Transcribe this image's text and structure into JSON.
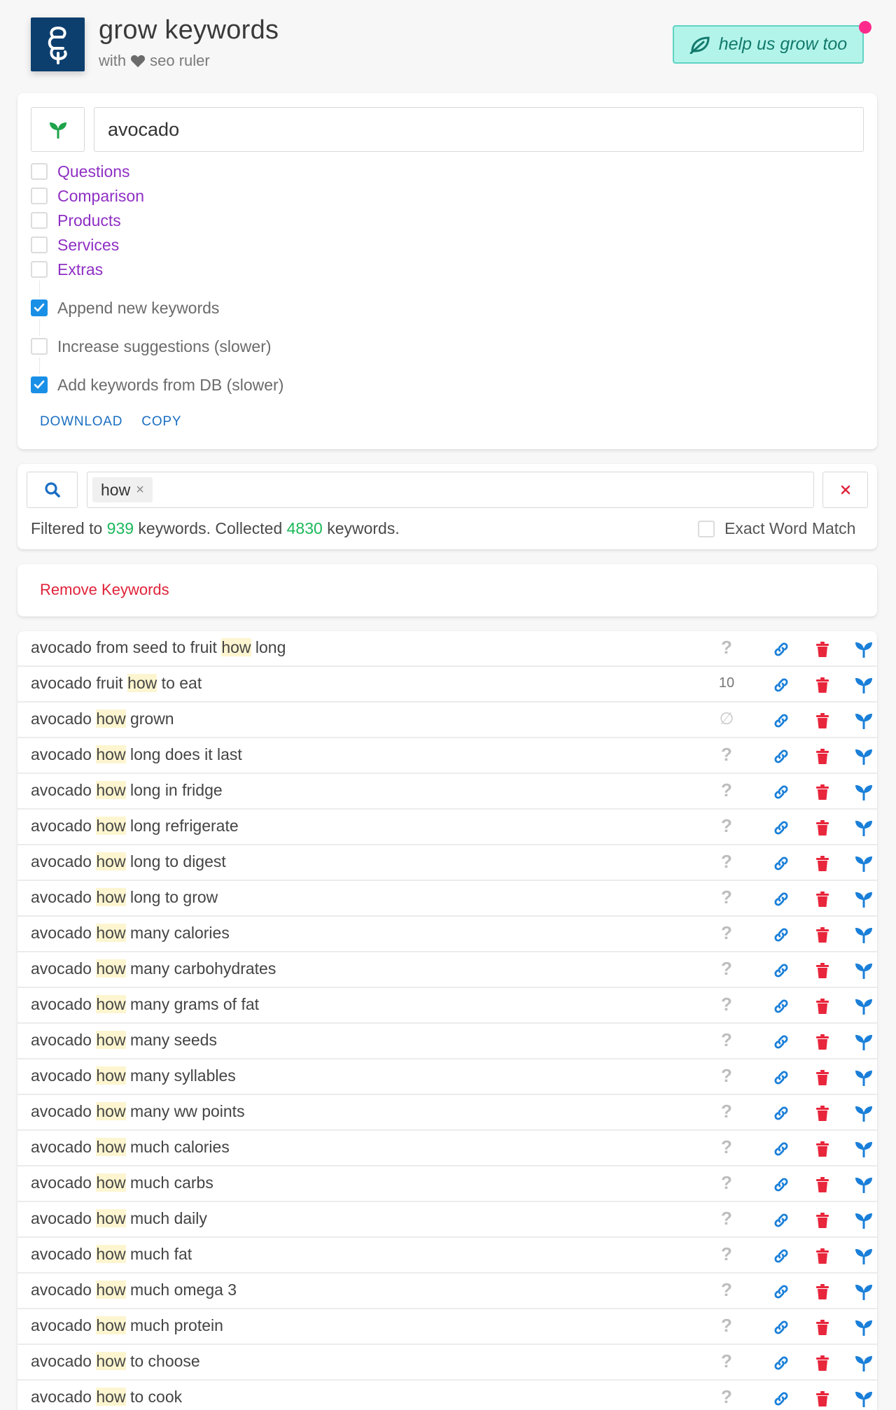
{
  "header": {
    "title": "grow keywords",
    "sub_with": "with",
    "sub_brand": "seo ruler",
    "help_label": "help us grow too"
  },
  "search": {
    "value": "avocado"
  },
  "options": {
    "categories": [
      {
        "label": "Questions",
        "checked": false
      },
      {
        "label": "Comparison",
        "checked": false
      },
      {
        "label": "Products",
        "checked": false
      },
      {
        "label": "Services",
        "checked": false
      },
      {
        "label": "Extras",
        "checked": false
      }
    ],
    "settings": [
      {
        "label": "Append new keywords",
        "checked": true
      },
      {
        "label": "Increase suggestions (slower)",
        "checked": false
      },
      {
        "label": "Add keywords from DB (slower)",
        "checked": true
      }
    ],
    "download_label": "DOWNLOAD",
    "copy_label": "COPY"
  },
  "filter": {
    "tag": "how",
    "status_prefix": "Filtered to",
    "filtered_count": "939",
    "status_mid": "keywords. Collected",
    "collected_count": "4830",
    "status_suffix": "keywords.",
    "exact_label": "Exact Word Match",
    "exact_checked": false
  },
  "remove": {
    "label": "Remove Keywords"
  },
  "colors": {
    "accent_blue": "#1a8fe6",
    "purple": "#8f2fc4",
    "green": "#1cb85a",
    "red": "#e0223a",
    "teal": "#b3f4ea",
    "logo_navy": "#0d3f6e"
  },
  "keywords": [
    {
      "pre": "avocado from seed to fruit ",
      "hl": "how",
      "post": " long",
      "volume": "?"
    },
    {
      "pre": "avocado fruit ",
      "hl": "how",
      "post": " to eat",
      "volume": "10"
    },
    {
      "pre": "avocado ",
      "hl": "how",
      "post": " grown",
      "volume": "∅"
    },
    {
      "pre": "avocado ",
      "hl": "how",
      "post": " long does it last",
      "volume": "?"
    },
    {
      "pre": "avocado ",
      "hl": "how",
      "post": " long in fridge",
      "volume": "?"
    },
    {
      "pre": "avocado ",
      "hl": "how",
      "post": " long refrigerate",
      "volume": "?"
    },
    {
      "pre": "avocado ",
      "hl": "how",
      "post": " long to digest",
      "volume": "?"
    },
    {
      "pre": "avocado ",
      "hl": "how",
      "post": " long to grow",
      "volume": "?"
    },
    {
      "pre": "avocado ",
      "hl": "how",
      "post": " many calories",
      "volume": "?"
    },
    {
      "pre": "avocado ",
      "hl": "how",
      "post": " many carbohydrates",
      "volume": "?"
    },
    {
      "pre": "avocado ",
      "hl": "how",
      "post": " many grams of fat",
      "volume": "?"
    },
    {
      "pre": "avocado ",
      "hl": "how",
      "post": " many seeds",
      "volume": "?"
    },
    {
      "pre": "avocado ",
      "hl": "how",
      "post": " many syllables",
      "volume": "?"
    },
    {
      "pre": "avocado ",
      "hl": "how",
      "post": " many ww points",
      "volume": "?"
    },
    {
      "pre": "avocado ",
      "hl": "how",
      "post": " much calories",
      "volume": "?"
    },
    {
      "pre": "avocado ",
      "hl": "how",
      "post": " much carbs",
      "volume": "?"
    },
    {
      "pre": "avocado ",
      "hl": "how",
      "post": " much daily",
      "volume": "?"
    },
    {
      "pre": "avocado ",
      "hl": "how",
      "post": " much fat",
      "volume": "?"
    },
    {
      "pre": "avocado ",
      "hl": "how",
      "post": " much omega 3",
      "volume": "?"
    },
    {
      "pre": "avocado ",
      "hl": "how",
      "post": " much protein",
      "volume": "?"
    },
    {
      "pre": "avocado ",
      "hl": "how",
      "post": " to choose",
      "volume": "?"
    },
    {
      "pre": "avocado ",
      "hl": "how",
      "post": " to cook",
      "volume": "?"
    }
  ]
}
